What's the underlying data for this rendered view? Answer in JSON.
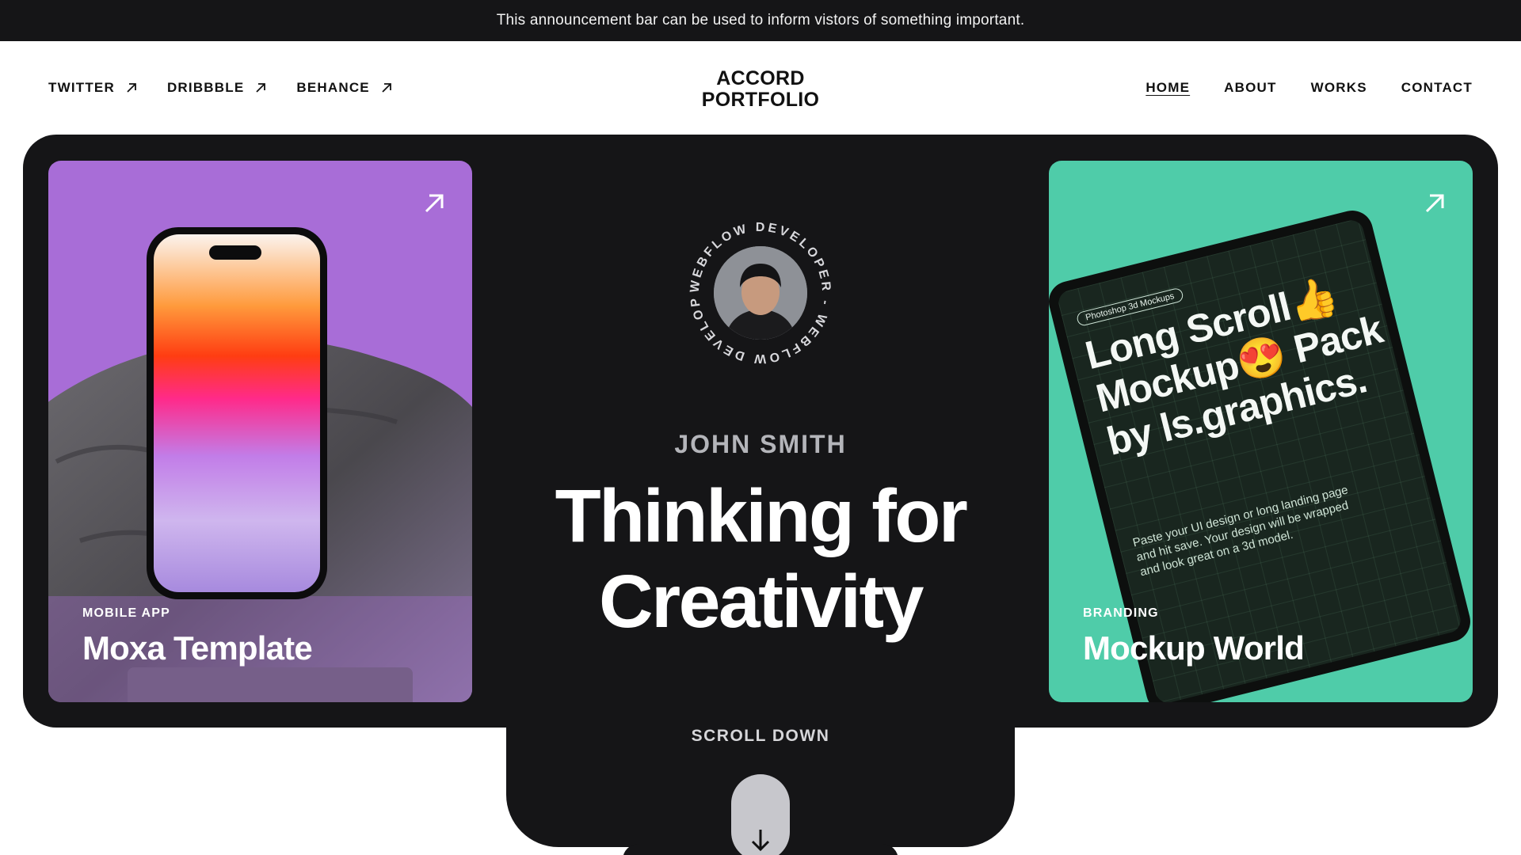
{
  "announcement": "This announcement bar can be used to inform vistors of something important.",
  "nav": {
    "social": [
      "TWITTER",
      "DRIBBBLE",
      "BEHANCE"
    ],
    "logo_line1": "ACCORD",
    "logo_line2": "PORTFOLIO",
    "menu": [
      "HOME",
      "ABOUT",
      "WORKS",
      "CONTACT"
    ],
    "active": "HOME"
  },
  "hero": {
    "badge_text": "WEBFLOW DEVELOPER - WEBFLOW DEVELOPER - ",
    "name": "JOHN SMITH",
    "headline_line1": "Thinking for",
    "headline_line2": "Creativity",
    "scroll_label": "SCROLL DOWN"
  },
  "cards": [
    {
      "category": "MOBILE APP",
      "title": "Moxa Template",
      "color": "#a86dd7"
    },
    {
      "category": "BRANDING",
      "title": "Mockup World",
      "color": "#4fcca9",
      "mockup": {
        "pill": "Photoshop 3d Mockups",
        "big": "Long Scroll👍 Mockup😍 Pack by ls.graphics.",
        "small": "Paste your UI design or long landing page and hit save. Your design will be wrapped and look great on a 3d model."
      }
    }
  ],
  "colors": {
    "dark": "#151517",
    "purple": "#a86dd7",
    "green": "#4fcca9"
  }
}
